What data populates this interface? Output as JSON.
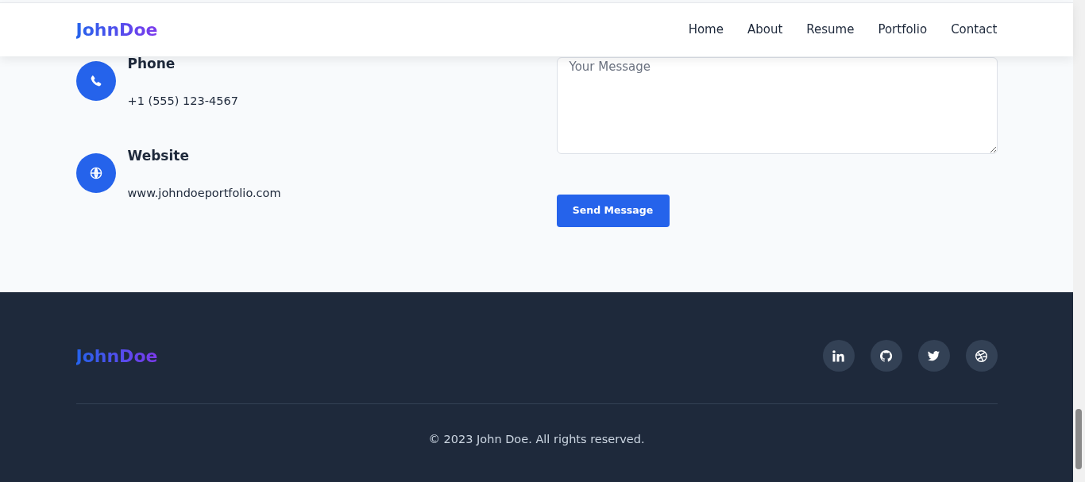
{
  "navbar": {
    "logo": "JohnDoe",
    "links": [
      {
        "label": "Home"
      },
      {
        "label": "About"
      },
      {
        "label": "Resume"
      },
      {
        "label": "Portfolio"
      },
      {
        "label": "Contact"
      }
    ]
  },
  "contact_items": [
    {
      "kind": "phone",
      "title": "Phone",
      "value": "+1 (555) 123-4567"
    },
    {
      "kind": "website",
      "title": "Website",
      "value": "www.johndoeportfolio.com"
    }
  ],
  "form": {
    "message": {
      "placeholder": "Your Message"
    },
    "submit": "Send Message"
  },
  "footer": {
    "logo": "JohnDoe",
    "social": [
      {
        "kind": "linkedin"
      },
      {
        "kind": "github"
      },
      {
        "kind": "twitter"
      },
      {
        "kind": "dribbble"
      }
    ],
    "copyright": "© 2023 John Doe. All rights reserved."
  }
}
